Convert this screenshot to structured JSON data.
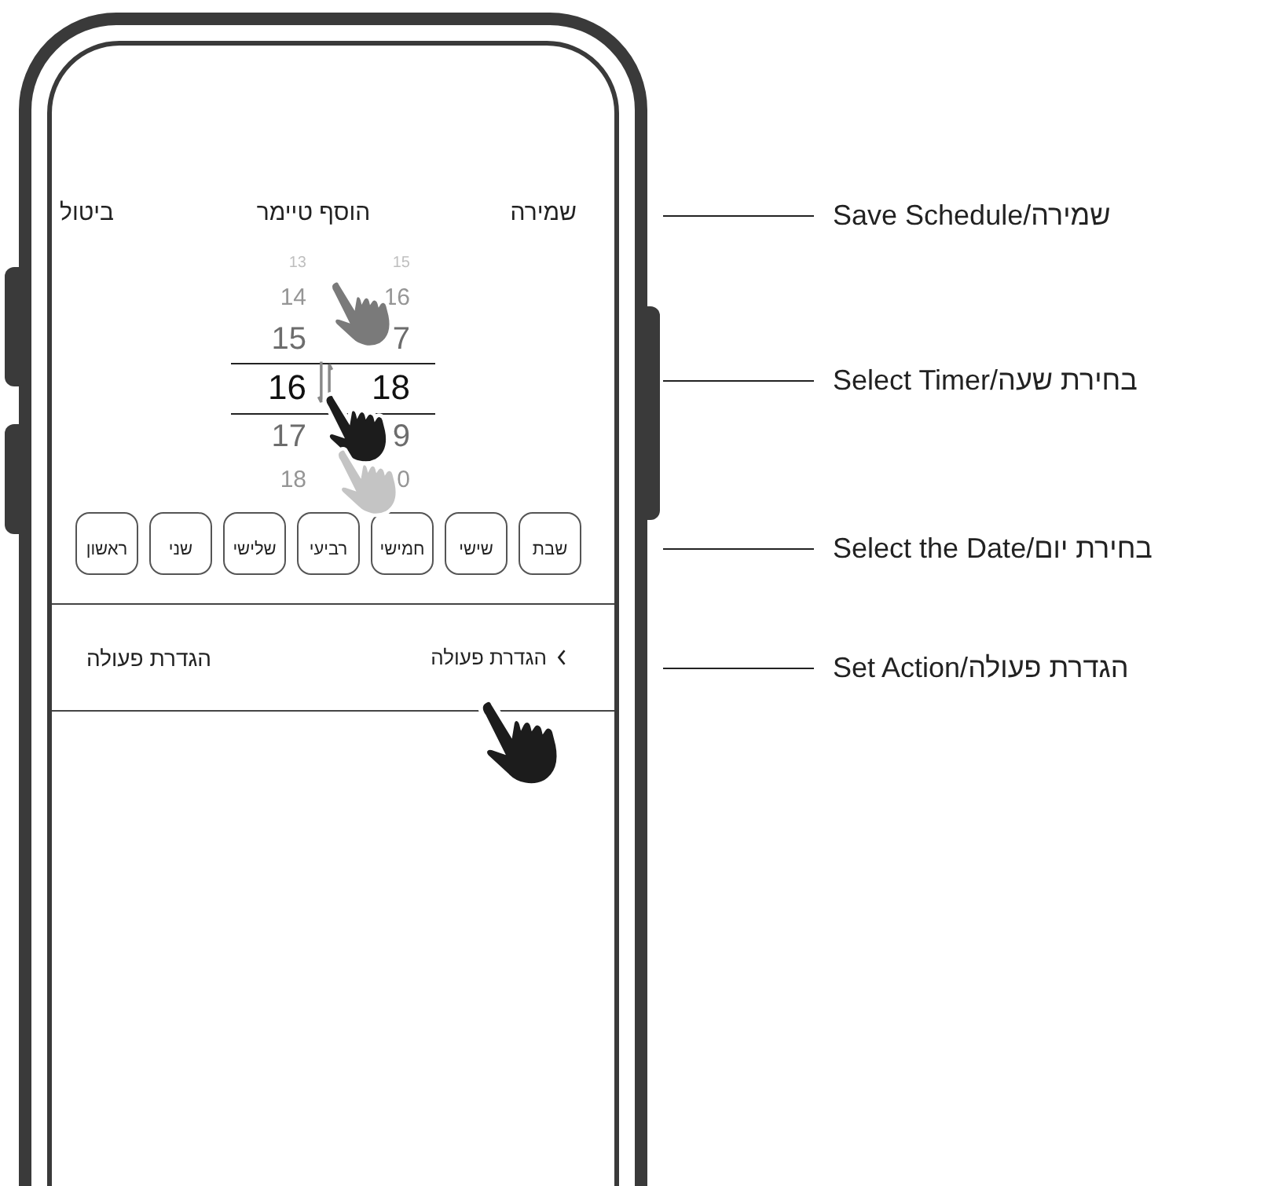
{
  "header": {
    "cancel": "ביטול",
    "title": "הוסף טיימר",
    "save": "שמירה"
  },
  "picker": {
    "columns": [
      {
        "items": [
          {
            "text": "15",
            "selected": false
          },
          {
            "text": "16",
            "selected": false
          },
          {
            "text": "7",
            "selected": false
          },
          {
            "text": "18",
            "selected": true
          },
          {
            "text": "9",
            "selected": false
          },
          {
            "text": "0",
            "selected": false
          }
        ]
      },
      {
        "items": [
          {
            "text": "13",
            "selected": false
          },
          {
            "text": "14",
            "selected": false
          },
          {
            "text": "15",
            "selected": false
          },
          {
            "text": "16",
            "selected": true
          },
          {
            "text": "17",
            "selected": false
          },
          {
            "text": "18",
            "selected": false
          }
        ]
      }
    ]
  },
  "days": [
    {
      "label": "שבת"
    },
    {
      "label": "שישי"
    },
    {
      "label": "חמישי"
    },
    {
      "label": "רביעי"
    },
    {
      "label": "שלישי"
    },
    {
      "label": "שני"
    },
    {
      "label": "ראשון"
    }
  ],
  "action_row": {
    "label": "הגדרת פעולה",
    "value": "הגדרת פעולה"
  },
  "annotations": [
    {
      "text": "Save Schedule/שמירה"
    },
    {
      "text": "Select Timer/בחירת שעה"
    },
    {
      "text": "Select the Date/בחירת יום"
    },
    {
      "text": "Set Action/הגדרת פעולה"
    }
  ]
}
